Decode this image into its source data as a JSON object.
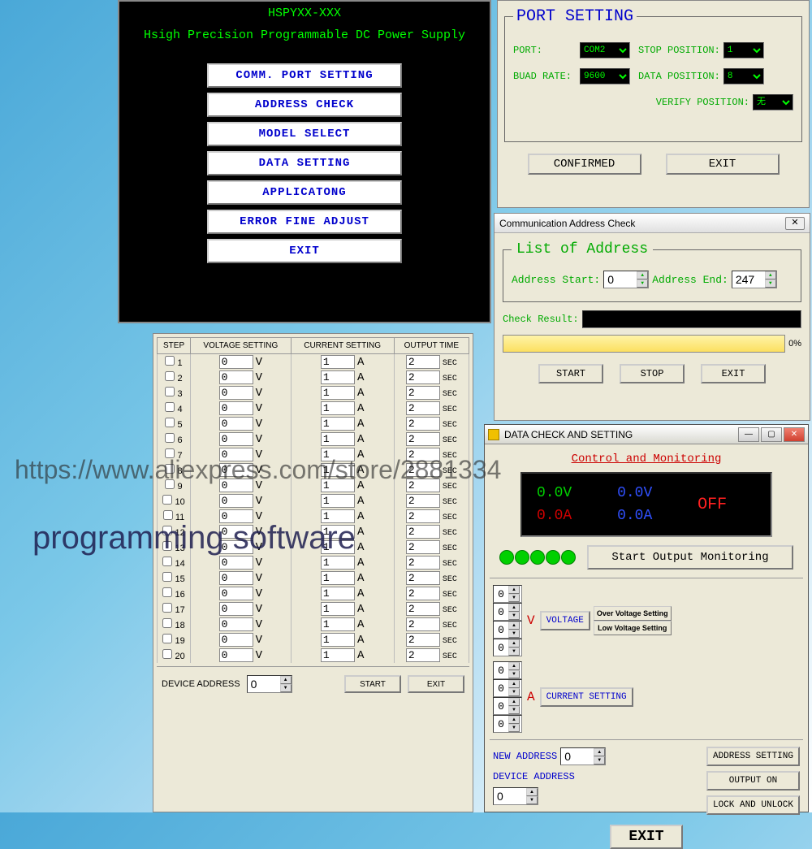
{
  "main_menu": {
    "title1": "HSPYXX-XXX",
    "title2": "Hsigh Precision Programmable DC Power Supply",
    "buttons": {
      "comm": "COMM. PORT SETTING",
      "addr": "ADDRESS CHECK",
      "model": "MODEL  SELECT",
      "data": "DATA  SETTING",
      "app": "APPLICATONG",
      "error": "ERROR FINE ADJUST",
      "exit": "EXIT"
    }
  },
  "port": {
    "legend": "PORT SETTING",
    "labels": {
      "port": "PORT:",
      "stop": "STOP POSITION:",
      "baud": "BUAD RATE:",
      "data": "DATA POSITION:",
      "verify": "VERIFY POSITION:"
    },
    "values": {
      "port": "COM2",
      "stop": "1",
      "baud": "9600",
      "data": "8",
      "verify": "无"
    },
    "buttons": {
      "confirm": "CONFIRMED",
      "exit": "EXIT"
    }
  },
  "addr": {
    "titlebar": "Communication Address Check",
    "legend": "List of Address",
    "labels": {
      "start": "Address Start:",
      "end": "Address End:"
    },
    "values": {
      "start": "0",
      "end": "247"
    },
    "check_label": "Check Result:",
    "progress": "0%",
    "buttons": {
      "start": "START",
      "stop": "STOP",
      "exit": "EXIT"
    }
  },
  "steps": {
    "headers": {
      "step": "STEP",
      "volt": "VOLTAGE SETTING",
      "curr": "CURRENT SETTING",
      "time": "OUTPUT TIME"
    },
    "rows": [
      {
        "n": "1",
        "v": "0",
        "a": "1",
        "t": "2"
      },
      {
        "n": "2",
        "v": "0",
        "a": "1",
        "t": "2"
      },
      {
        "n": "3",
        "v": "0",
        "a": "1",
        "t": "2"
      },
      {
        "n": "4",
        "v": "0",
        "a": "1",
        "t": "2"
      },
      {
        "n": "5",
        "v": "0",
        "a": "1",
        "t": "2"
      },
      {
        "n": "6",
        "v": "0",
        "a": "1",
        "t": "2"
      },
      {
        "n": "7",
        "v": "0",
        "a": "1",
        "t": "2"
      },
      {
        "n": "8",
        "v": "0",
        "a": "1",
        "t": "2"
      },
      {
        "n": "9",
        "v": "0",
        "a": "1",
        "t": "2"
      },
      {
        "n": "10",
        "v": "0",
        "a": "1",
        "t": "2"
      },
      {
        "n": "11",
        "v": "0",
        "a": "1",
        "t": "2"
      },
      {
        "n": "12",
        "v": "0",
        "a": "1",
        "t": "2"
      },
      {
        "n": "13",
        "v": "0",
        "a": "1",
        "t": "2"
      },
      {
        "n": "14",
        "v": "0",
        "a": "1",
        "t": "2"
      },
      {
        "n": "15",
        "v": "0",
        "a": "1",
        "t": "2"
      },
      {
        "n": "16",
        "v": "0",
        "a": "1",
        "t": "2"
      },
      {
        "n": "17",
        "v": "0",
        "a": "1",
        "t": "2"
      },
      {
        "n": "18",
        "v": "0",
        "a": "1",
        "t": "2"
      },
      {
        "n": "19",
        "v": "0",
        "a": "1",
        "t": "2"
      },
      {
        "n": "20",
        "v": "0",
        "a": "1",
        "t": "2"
      }
    ],
    "units": {
      "v": "V",
      "a": "A",
      "t": "SEC"
    },
    "footer": {
      "dev_addr_label": "DEVICE ADDRESS",
      "dev_addr": "0",
      "start": "START",
      "exit": "EXIT"
    }
  },
  "datacheck": {
    "titlebar": "DATA CHECK AND SETTING",
    "monitor_title": "Control and Monitoring",
    "monitor": {
      "v1": "0.0V",
      "v2": "0.0V",
      "a1": "0.0A",
      "a2": "0.0A",
      "state": "OFF"
    },
    "start_mon": "Start Output Monitoring",
    "digits": [
      "0",
      "0",
      "0",
      "0"
    ],
    "labels": {
      "v": "V",
      "a": "A",
      "voltage_btn": "VOLTAGE",
      "current_btn": "CURRENT SETTING",
      "over_v": "Over Voltage Setting",
      "low_v": "Low Voltage Setting",
      "new_addr": "NEW ADDRESS",
      "new_addr_val": "0",
      "addr_set": "ADDRESS SETTING",
      "dev_addr": "DEVICE ADDRESS",
      "dev_addr_val": "0",
      "output_on": "OUTPUT ON",
      "lock": "LOCK AND UNLOCK",
      "exit": "EXIT"
    }
  },
  "watermark": {
    "url": "https://www.aliexpress.com/store/2881334",
    "text": "programming software"
  }
}
